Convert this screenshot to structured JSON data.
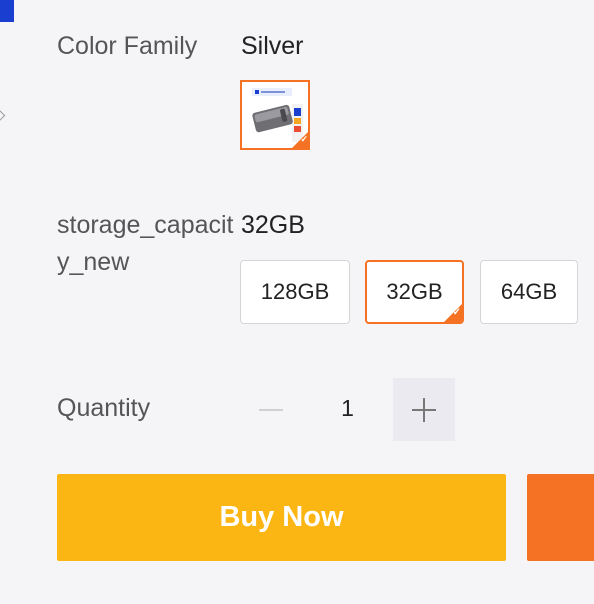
{
  "product": {
    "color_family_label": "Color Family",
    "color_family_value": "Silver",
    "color_swatch": {
      "name": "Silver",
      "selected": true
    },
    "storage_label": "storage_capacity_new",
    "storage_value": "32GB",
    "storage_options": [
      {
        "label": "128GB",
        "selected": false
      },
      {
        "label": "32GB",
        "selected": true
      },
      {
        "label": "64GB",
        "selected": false
      }
    ],
    "quantity_label": "Quantity",
    "quantity_value": "1",
    "quantity_minus_icon": "minus-icon",
    "quantity_plus_icon": "plus-icon"
  },
  "actions": {
    "buy_now_label": "Buy Now",
    "add_to_cart_label": ""
  },
  "colors": {
    "accent_orange": "#f57224",
    "buy_now_yellow": "#fcb614",
    "brand_blue": "#1a3fd0"
  }
}
